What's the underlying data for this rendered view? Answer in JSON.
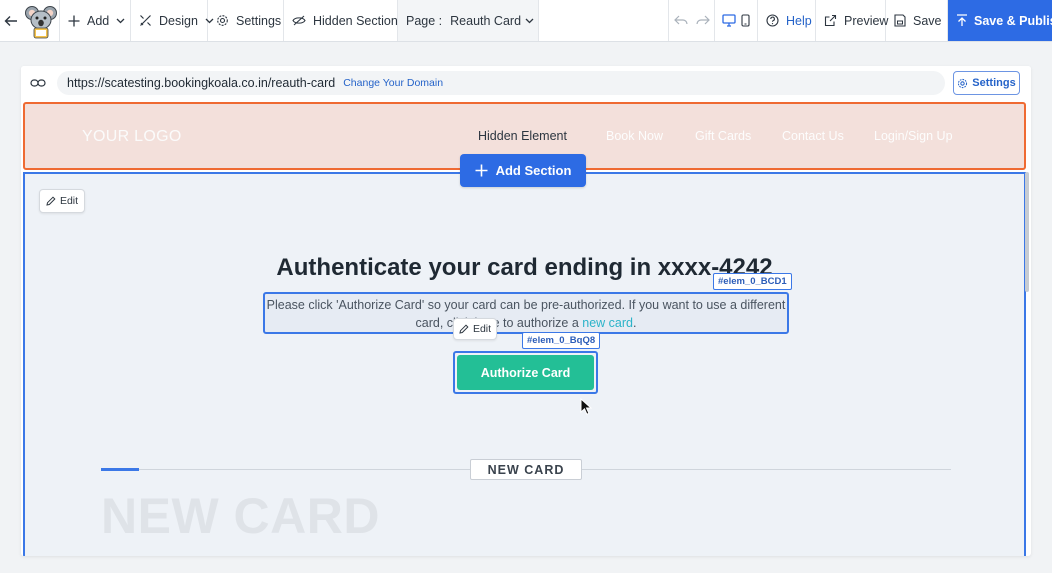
{
  "toolbar": {
    "add_label": "Add",
    "design_label": "Design",
    "settings_label": "Settings",
    "hidden_sections_label": "Hidden Sections",
    "page_prefix": "Page :",
    "page_name": "Reauth Card",
    "help_label": "Help",
    "preview_label": "Preview",
    "save_label": "Save",
    "publish_label": "Save & Publish"
  },
  "browser": {
    "url": "https://scatesting.bookingkoala.co.in/reauth-card",
    "change_domain_label": "Change Your Domain",
    "settings_label": "Settings"
  },
  "header": {
    "logo_text": "YOUR LOGO",
    "nav_items": [
      "Hidden Element",
      "Book Now",
      "Gift Cards",
      "Contact Us",
      "Login/Sign Up"
    ],
    "add_section_label": "Add Section"
  },
  "main": {
    "edit_label": "Edit",
    "heading": "Authenticate your card ending in xxxx-4242",
    "elem_tag_1": "#elem_0_BCD1",
    "paragraph_line1": "Please click 'Authorize Card' so your card can be pre-authorized. If you want to use a different",
    "paragraph_line2_pre": "card, click here to authorize a",
    "paragraph_link": "new card",
    "paragraph_line2_post": ".",
    "edit_label_2": "Edit",
    "elem_tag_2": "#elem_0_BqQ8",
    "authorize_button": "Authorize Card",
    "new_card_label": "NEW CARD",
    "new_card_watermark": "NEW CARD"
  },
  "colors": {
    "accent": "#2d6be4",
    "authorize": "#23bf96",
    "header_highlight": "#ef6a32",
    "selection": "#3b78e7"
  }
}
